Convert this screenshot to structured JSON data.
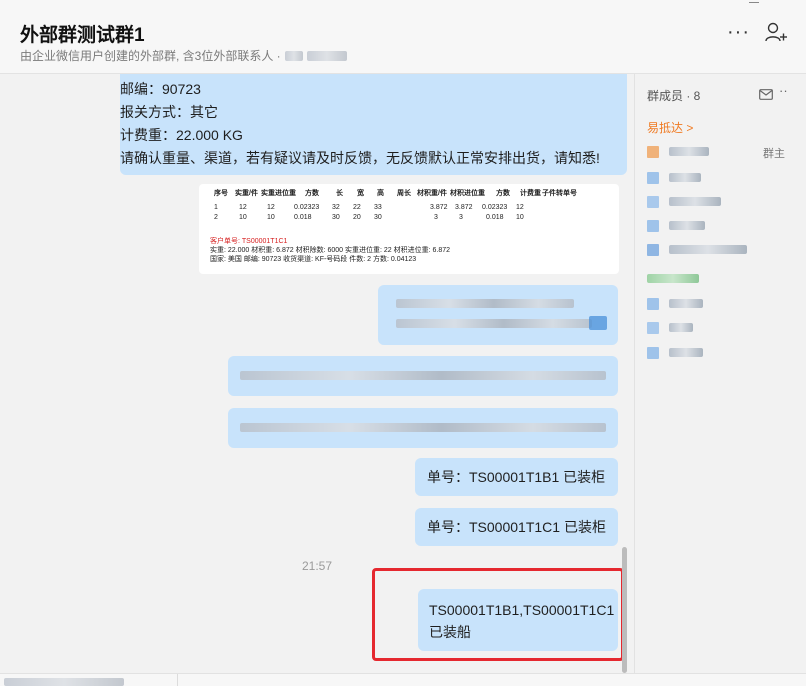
{
  "header": {
    "title": "外部群测试群1",
    "subtitle": "由企业微信用户创建的外部群, 含3位外部联系人 ·",
    "more_label": "···"
  },
  "chat": {
    "long_message_lines": [
      "邮编：90723",
      "报关方式：其它",
      "计费重：22.000 KG",
      "请确认重量、渠道，若有疑议请及时反馈，无反馈默认正常安排出货，请知悉!"
    ],
    "image_card": {
      "header": [
        "序号",
        "实重/件",
        "实重进位重",
        "方数",
        "长",
        "宽",
        "高",
        "周长",
        "材积重/件",
        "材积进位重",
        "方数",
        "计费重",
        "子件转单号"
      ],
      "rows": [
        [
          "1",
          "12",
          "12",
          "0.02323",
          "32",
          "22",
          "33",
          "",
          "3.872",
          "3.872",
          "0.02323",
          "12",
          ""
        ],
        [
          "2",
          "10",
          "10",
          "0.018",
          "30",
          "20",
          "30",
          "",
          "3",
          "3",
          "0.018",
          "10",
          ""
        ]
      ],
      "customer_no": "客户单号: TS00001T1C1",
      "line2": "实重: 22.000   材积重: 6.872   材积除数: 6000  实重进位重: 22   材积进位重: 6.872",
      "line3": "国家: 美国  邮编: 90723  收货渠道: KF-号码段   件数: 2  方数: 0.04123"
    },
    "msg1": "单号：TS00001T1B1   已装柜",
    "msg2": "单号：TS00001T1C1   已装柜",
    "time": "21:57",
    "final_line1": "TS00001T1B1,TS00001T1C1",
    "final_line2": "已装船"
  },
  "members": {
    "header": "群成员 · 8",
    "company_link": "易抵达 >",
    "owner_badge": "群主",
    "avatar_colors": [
      "#f0b27a",
      "#9fc3ea",
      "#a9c9ec",
      "#9fc3ea",
      "#8fb6e3",
      "#9fc3ea",
      "#a9c9ec",
      "#9fc3ea"
    ]
  },
  "colors": {
    "bubble": "#c8e3fb",
    "highlight_box": "#e5282f",
    "link": "#f07a22"
  }
}
